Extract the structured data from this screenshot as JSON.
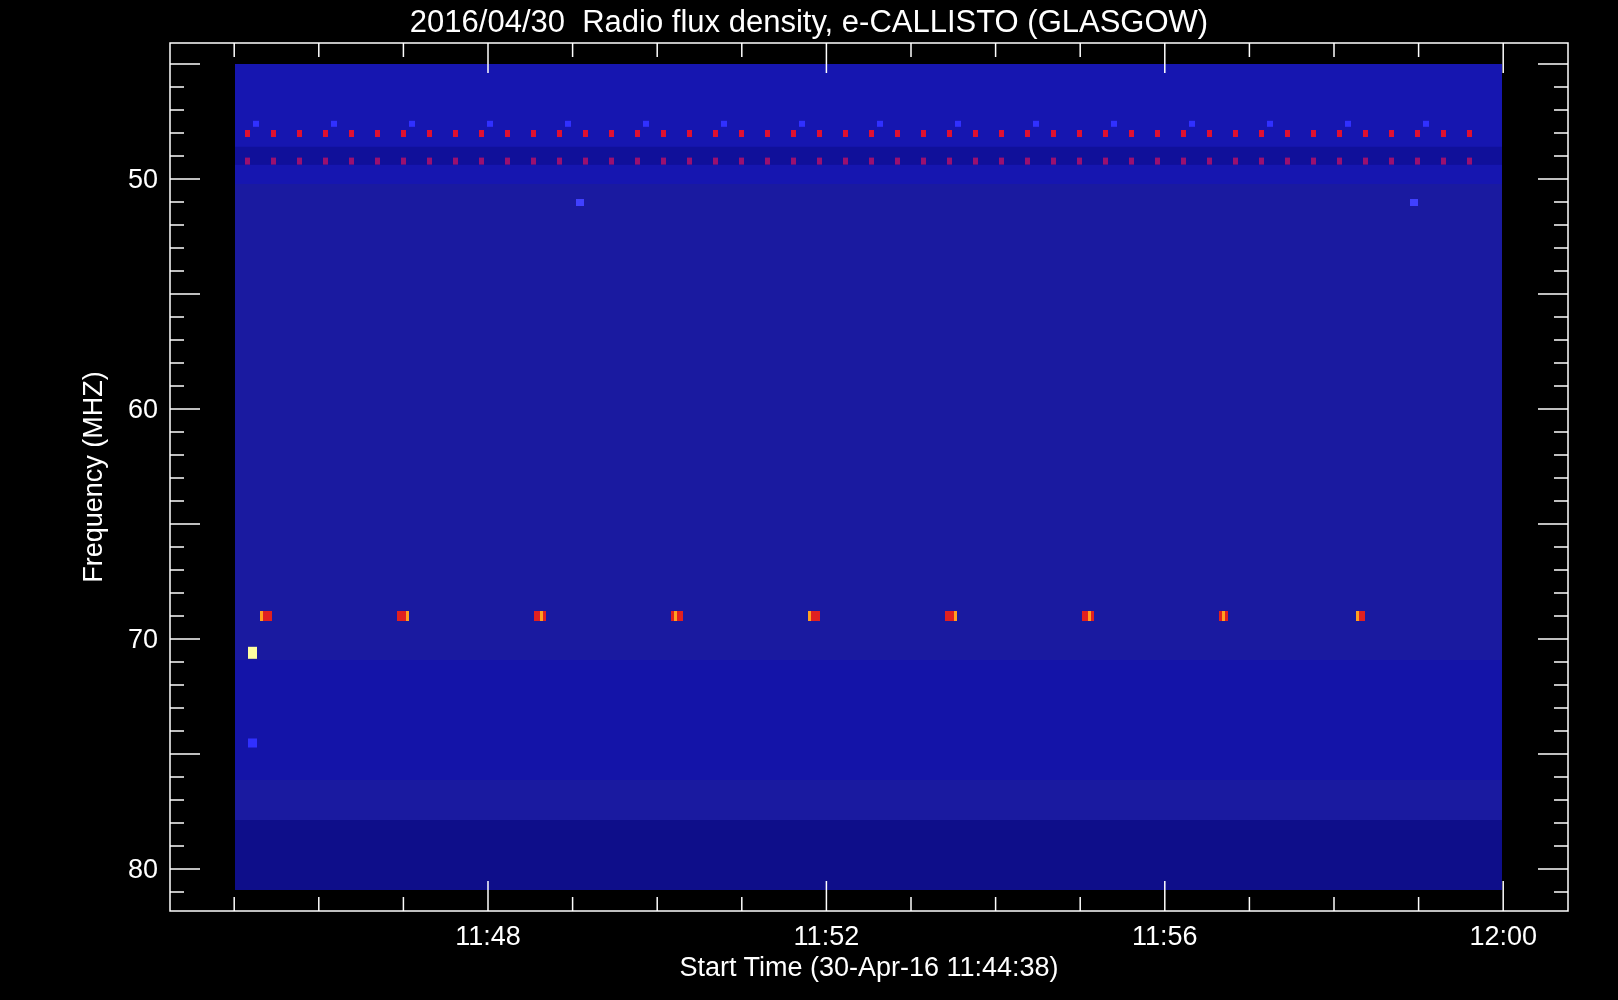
{
  "title": "2016/04/30  Radio flux density, e-CALLISTO (GLASGOW)",
  "x_axis": {
    "label": "Start Time (30-Apr-16 11:44:38)",
    "ticks": [
      "11:48",
      "11:52",
      "11:56",
      "12:00"
    ]
  },
  "y_axis": {
    "label": "Frequency (MHZ)",
    "ticks": [
      "50",
      "60",
      "70",
      "80"
    ]
  }
}
